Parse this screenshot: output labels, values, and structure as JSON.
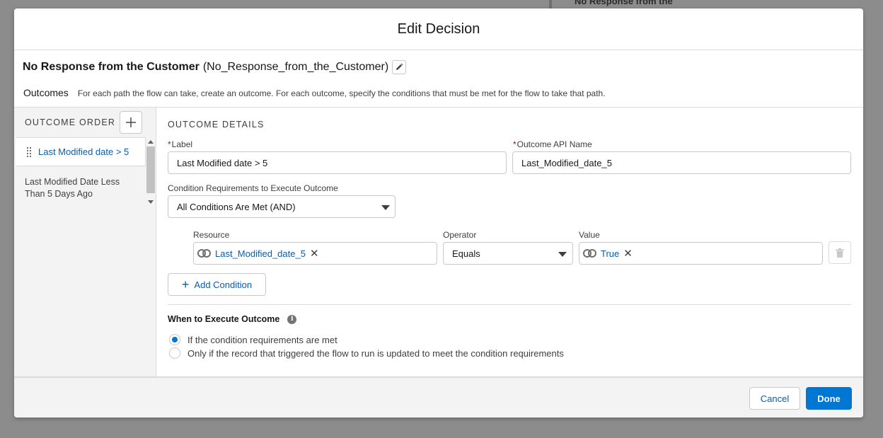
{
  "background": {
    "node_text": "No Response from the"
  },
  "modal": {
    "title": "Edit Decision",
    "decision_name": "No Response from the Customer",
    "decision_api_name": "(No_Response_from_the_Customer)",
    "outcomes_label": "Outcomes",
    "outcomes_description": "For each path the flow can take, create an outcome. For each outcome, specify the conditions that must be met for the flow to take that path."
  },
  "outcome_order": {
    "label": "OUTCOME ORDER",
    "items": [
      {
        "label": "Last Modified date > 5",
        "active": true
      },
      {
        "label": "Last Modified Date Less Than 5 Days Ago",
        "active": false
      }
    ]
  },
  "details": {
    "section_title": "OUTCOME DETAILS",
    "label_field": {
      "label": "Label",
      "value": "Last Modified date > 5"
    },
    "api_field": {
      "label": "Outcome API Name",
      "value": "Last_Modified_date_5"
    },
    "condition_req": {
      "label": "Condition Requirements to Execute Outcome",
      "value": "All Conditions Are Met (AND)"
    },
    "condition": {
      "resource_label": "Resource",
      "resource_value": "Last_Modified_date_5",
      "operator_label": "Operator",
      "operator_value": "Equals",
      "value_label": "Value",
      "value_value": "True"
    },
    "add_condition": "Add Condition",
    "when_label": "When to Execute Outcome",
    "radio_options": [
      {
        "label": "If the condition requirements are met",
        "checked": true
      },
      {
        "label": "Only if the record that triggered the flow to run is updated to meet the condition requirements",
        "checked": false
      }
    ]
  },
  "footer": {
    "cancel": "Cancel",
    "done": "Done"
  },
  "colors": {
    "brand": "#0176d3",
    "link": "#0b5cab",
    "required": "#ba0517"
  }
}
